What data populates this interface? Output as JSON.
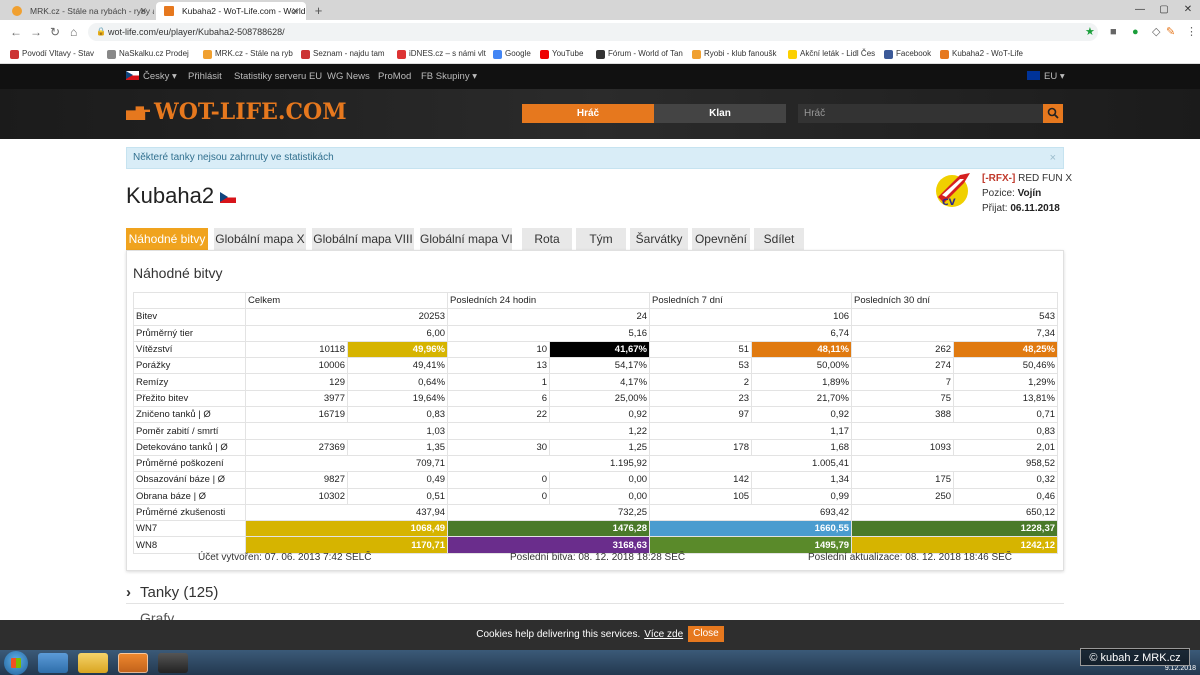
{
  "browser": {
    "tabs": [
      {
        "title": "MRK.cz - Stále na rybách - ryby a rybaření"
      },
      {
        "title": "Kubaha2 - WoT-Life.com - World of Tanks"
      }
    ],
    "url": "wot-life.com/eu/player/Kubaha2-508788628/",
    "bookmarks": [
      "Povodí Vltavy - Stav",
      "NaSkalku.cz Prodej",
      "MRK.cz - Stále na ryb",
      "Seznam - najdu tam",
      "iDNES.cz – s námi vlt",
      "Google",
      "YouTube",
      "Fórum - World of Tan",
      "Ryobi - klub fanoušk",
      "Akční leták - Lidl Čes",
      "Facebook",
      "Kubaha2 - WoT-Life"
    ]
  },
  "sitenav": {
    "lang": "Česky",
    "items": [
      "Přihlásit",
      "Statistiky serveru EU",
      "WG News",
      "ProMod",
      "FB Skupiny"
    ],
    "region": "EU"
  },
  "header": {
    "logo": "WOT-LIFE.COM",
    "btn_player": "Hráč",
    "btn_clan": "Klan",
    "search_placeholder": "Hráč"
  },
  "alert": "Některé tanky nejsou zahrnuty ve statistikách",
  "player": {
    "name": "Kubaha2"
  },
  "clan": {
    "tag": "[-RFX-]",
    "name": "RED FUN X",
    "position_label": "Pozice:",
    "position": "Vojín",
    "joined_label": "Přijat:",
    "joined": "06.11.2018"
  },
  "tabs": [
    "Náhodné bitvy",
    "Globální mapa X",
    "Globální mapa VIII",
    "Globální mapa VI",
    "Rota",
    "Tým",
    "Šarvátky",
    "Opevnění",
    "Sdílet"
  ],
  "panel_title": "Náhodné bitvy",
  "table": {
    "headers": [
      "",
      "Celkem",
      "Posledních 24 hodin",
      "Posledních 7 dní",
      "Posledních 30 dní"
    ],
    "rows": [
      {
        "label": "Bitev",
        "cells": [
          "20253",
          "24",
          "106",
          "543"
        ]
      },
      {
        "label": "Průměrný tier",
        "cells": [
          "6,00",
          "5,16",
          "6,74",
          "7,34"
        ]
      },
      {
        "label": "Vítězství",
        "cells": [
          [
            "10118",
            "49,96%"
          ],
          [
            "10",
            "41,67%"
          ],
          [
            "51",
            "48,11%"
          ],
          [
            "262",
            "48,25%"
          ]
        ],
        "colors": [
          "#d6b400",
          "#000000",
          "#e07a10",
          "#e07a10"
        ]
      },
      {
        "label": "Porážky",
        "cells": [
          [
            "10006",
            "49,41%"
          ],
          [
            "13",
            "54,17%"
          ],
          [
            "53",
            "50,00%"
          ],
          [
            "274",
            "50,46%"
          ]
        ]
      },
      {
        "label": "Remízy",
        "cells": [
          [
            "129",
            "0,64%"
          ],
          [
            "1",
            "4,17%"
          ],
          [
            "2",
            "1,89%"
          ],
          [
            "7",
            "1,29%"
          ]
        ]
      },
      {
        "label": "Přežito bitev",
        "cells": [
          [
            "3977",
            "19,64%"
          ],
          [
            "6",
            "25,00%"
          ],
          [
            "23",
            "21,70%"
          ],
          [
            "75",
            "13,81%"
          ]
        ]
      },
      {
        "label": "Zničeno tanků | Ø",
        "cells": [
          [
            "16719",
            "0,83"
          ],
          [
            "22",
            "0,92"
          ],
          [
            "97",
            "0,92"
          ],
          [
            "388",
            "0,71"
          ]
        ]
      },
      {
        "label": "Poměr zabití / smrtí",
        "cells": [
          "1,03",
          "1,22",
          "1,17",
          "0,83"
        ]
      },
      {
        "label": "Detekováno tanků | Ø",
        "cells": [
          [
            "27369",
            "1,35"
          ],
          [
            "30",
            "1,25"
          ],
          [
            "178",
            "1,68"
          ],
          [
            "1093",
            "2,01"
          ]
        ]
      },
      {
        "label": "Průměrné poškození",
        "cells": [
          "709,71",
          "1.195,92",
          "1.005,41",
          "958,52"
        ]
      },
      {
        "label": "Obsazování báze | Ø",
        "cells": [
          [
            "9827",
            "0,49"
          ],
          [
            "0",
            "0,00"
          ],
          [
            "142",
            "1,34"
          ],
          [
            "175",
            "0,32"
          ]
        ]
      },
      {
        "label": "Obrana báze | Ø",
        "cells": [
          [
            "10302",
            "0,51"
          ],
          [
            "0",
            "0,00"
          ],
          [
            "105",
            "0,99"
          ],
          [
            "250",
            "0,46"
          ]
        ]
      },
      {
        "label": "Průměrné zkušenosti",
        "cells": [
          "437,94",
          "732,25",
          "693,42",
          "650,12"
        ]
      },
      {
        "label": "WN7",
        "cells": [
          "1068,49",
          "1476,28",
          "1660,55",
          "1228,37"
        ],
        "colors": [
          "#d6b400",
          "#4a7a2a",
          "#4a9ccf",
          "#4a7a2a"
        ]
      },
      {
        "label": "WN8",
        "cells": [
          "1170,71",
          "3168,63",
          "1495,79",
          "1242,12"
        ],
        "colors": [
          "#d6b400",
          "#6a2d8c",
          "#5a8a2a",
          "#d6b400"
        ]
      }
    ]
  },
  "footer": {
    "created": "Účet vytvořen: 07. 06. 2013 7:42 SELČ",
    "last_battle": "Poslední bitva: 08. 12. 2018 18:28 SEČ",
    "last_update": "Poslední aktualizace: 08. 12. 2018 18:46 SEČ"
  },
  "sections": {
    "tanks": "Tanky (125)",
    "next": "Grafy"
  },
  "cookie": {
    "text": "Cookies help delivering this services.",
    "link": "Více zde",
    "button": "Close"
  },
  "taskbar": {
    "date": "9.12.2018"
  },
  "watermark": "© kubah z MRK.cz"
}
